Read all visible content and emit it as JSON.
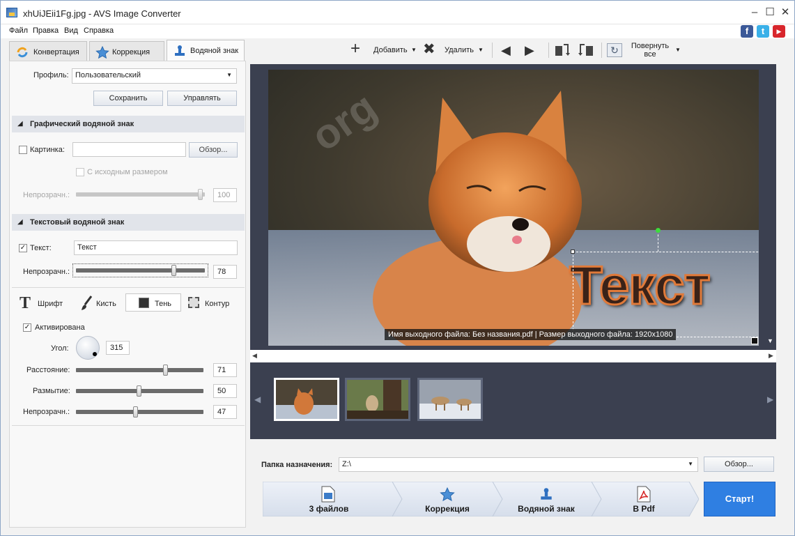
{
  "window": {
    "title": "xhUiJEii1Fg.jpg - AVS Image Converter"
  },
  "menu": [
    "Файл",
    "Правка",
    "Вид",
    "Справка"
  ],
  "social": [
    {
      "name": "facebook-icon",
      "glyph": "f",
      "color": "#3b5998"
    },
    {
      "name": "twitter-icon",
      "glyph": "t",
      "color": "#3ab0e8"
    },
    {
      "name": "youtube-icon",
      "glyph": "▶",
      "color": "#d8262c"
    }
  ],
  "tabs": [
    {
      "label": "Конвертация",
      "active": false
    },
    {
      "label": "Коррекция",
      "active": false
    },
    {
      "label": "Водяной знак",
      "active": true
    }
  ],
  "toolbar": {
    "add": "Добавить",
    "delete": "Удалить",
    "rotate_all": "Повернуть все",
    "rotate_line1": "Повернуть",
    "rotate_line2": "все"
  },
  "profile": {
    "label": "Профиль:",
    "value": "Пользовательский",
    "save": "Сохранить",
    "manage": "Управлять"
  },
  "graphic": {
    "title": "Графический водяной знак",
    "picture_label": "Картинка:",
    "picture_checked": false,
    "picture_value": "",
    "browse": "Обзор...",
    "original_size": "С исходным размером",
    "opacity_label": "Непрозрачн.:",
    "opacity_value": "100"
  },
  "text_wm": {
    "title": "Текстовый водяной знак",
    "text_label": "Текст:",
    "text_checked": true,
    "text_value": "Текст",
    "opacity_label": "Непрозрачн.:",
    "opacity_value": "78"
  },
  "style_tabs": [
    "Шрифт",
    "Кисть",
    "Тень",
    "Контур"
  ],
  "shadow": {
    "activated": "Активирована",
    "activated_checked": true,
    "angle_label": "Угол:",
    "angle_value": "315",
    "distance_label": "Расстояние:",
    "distance_value": "71",
    "blur_label": "Размытие:",
    "blur_value": "50",
    "opacity_label": "Непрозрачн.:",
    "opacity_value": "47"
  },
  "preview": {
    "watermark_text": "Текст",
    "status": "Имя выходного файла: Без названия.pdf | Размер выходного файла: 1920x1080"
  },
  "thumbnails": [
    {
      "name": "fox-thumbnail",
      "selected": true
    },
    {
      "name": "owl-thumbnail",
      "selected": false
    },
    {
      "name": "deer-thumbnail",
      "selected": false
    }
  ],
  "destination": {
    "label": "Папка назначения:",
    "value": "Z:\\",
    "browse": "Обзор..."
  },
  "steps": [
    "3 файлов",
    "Коррекция",
    "Водяной знак",
    "В Pdf"
  ],
  "start": "Старт!"
}
